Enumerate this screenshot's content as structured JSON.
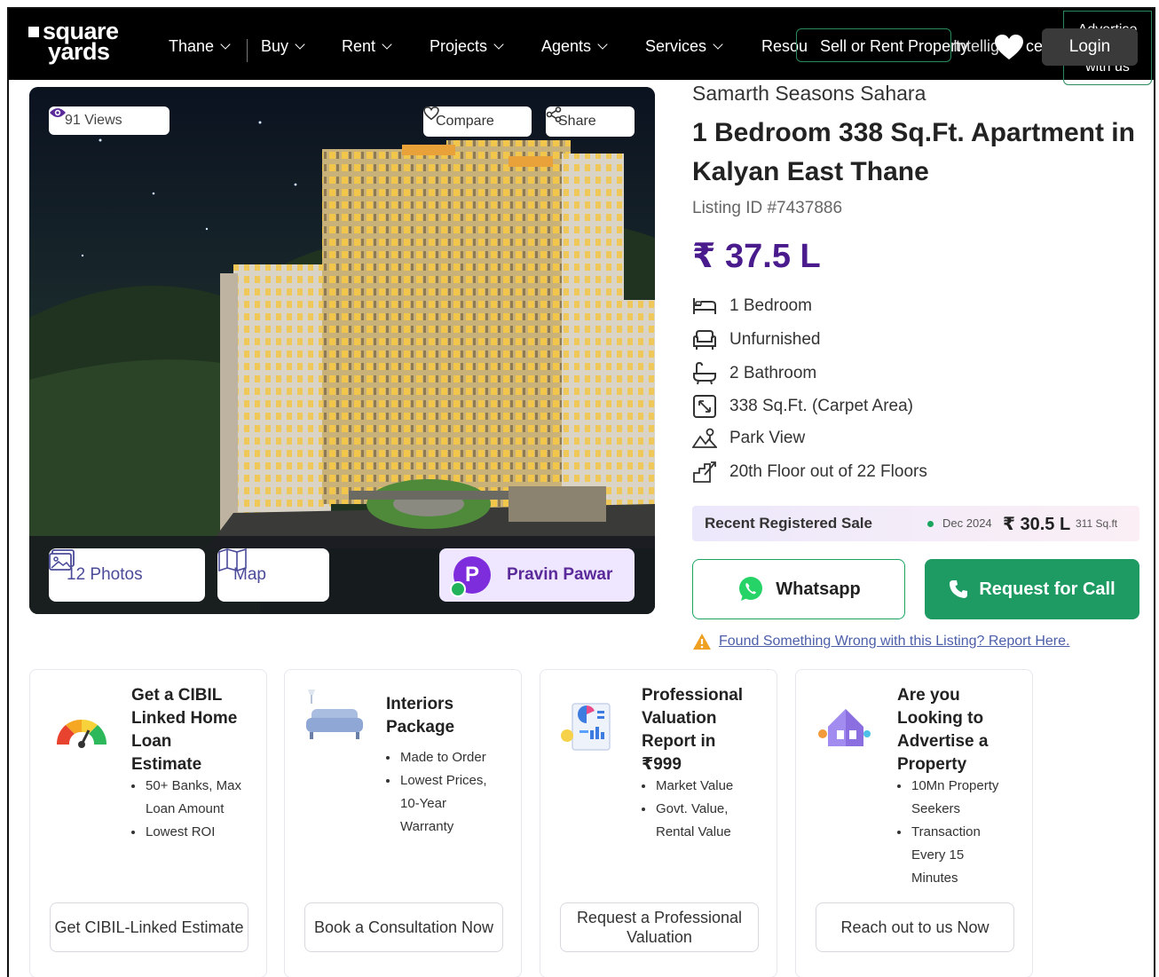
{
  "nav": {
    "logo_line1": "square",
    "logo_line2": "yards",
    "items": [
      {
        "label": "Thane"
      },
      {
        "label": "Buy"
      },
      {
        "label": "Rent"
      },
      {
        "label": "Projects"
      },
      {
        "label": "Agents"
      },
      {
        "label": "Services"
      }
    ],
    "resources_label": "Resou",
    "sell_label": "Sell or Rent Property",
    "intelligence_label": "Intellig",
    "intelligence_end": "ce",
    "advertise_label": "Advertise with us",
    "login_label": "Login",
    "accent_color": "#2a8a5c"
  },
  "hero": {
    "views": "91 Views",
    "compare": "Compare",
    "share": "Share",
    "photos": "12 Photos",
    "map": "Map",
    "agent_initial": "P",
    "agent_name": "Pravin Pawar"
  },
  "details": {
    "project": "Samarth Seasons Sahara",
    "title": "1 Bedroom 338 Sq.Ft. Apartment in Kalyan East Thane",
    "listing_id": "Listing ID #7437886",
    "price": "₹ 37.5 L",
    "price_color": "#4a1b8c",
    "features": [
      {
        "icon": "bed-icon",
        "label": "1 Bedroom"
      },
      {
        "icon": "sofa-icon",
        "label": "Unfurnished"
      },
      {
        "icon": "bathtub-icon",
        "label": "2 Bathroom"
      },
      {
        "icon": "area-icon",
        "label": "338 Sq.Ft. (Carpet Area)"
      },
      {
        "icon": "park-icon",
        "label": "Park View"
      },
      {
        "icon": "floor-icon",
        "label": "20th Floor out of 22 Floors"
      }
    ],
    "recent_sale": {
      "label": "Recent Registered Sale",
      "date": "Dec 2024",
      "price": "₹ 30.5 L",
      "area": "311 Sq.ft"
    },
    "whatsapp_label": "Whatsapp",
    "call_label": "Request for Call",
    "report_label": "Found Something Wrong with this Listing? Report Here."
  },
  "cards": [
    {
      "icon": "meter-icon",
      "title": [
        "Get a CIBIL",
        "Linked Home",
        "Loan",
        "Estimate"
      ],
      "bullets": [
        [
          "50+ Banks, Max",
          "Loan Amount"
        ],
        [
          "Lowest ROI"
        ]
      ],
      "button": "Get CIBIL-Linked Estimate"
    },
    {
      "icon": "sofa-icon",
      "title": [
        "Interiors",
        "Package"
      ],
      "bullets": [
        [
          "Made to Order"
        ],
        [
          "Lowest Prices,",
          "10-Year",
          "Warranty"
        ]
      ],
      "button": "Book a Consultation Now"
    },
    {
      "icon": "report-icon",
      "title": [
        "Professional",
        "Valuation",
        "Report in",
        "₹999"
      ],
      "bullets": [
        [
          "Market Value"
        ],
        [
          "Govt. Value,",
          "Rental Value"
        ]
      ],
      "button": "Request a Professional Valuation"
    },
    {
      "icon": "house-icon",
      "title": [
        "Are you",
        "Looking to",
        "Advertise a",
        "Property"
      ],
      "bullets": [
        [
          "10Mn Property",
          "Seekers"
        ],
        [
          "Transaction",
          "Every 15",
          "Minutes"
        ]
      ],
      "button": "Reach out to us Now"
    }
  ]
}
